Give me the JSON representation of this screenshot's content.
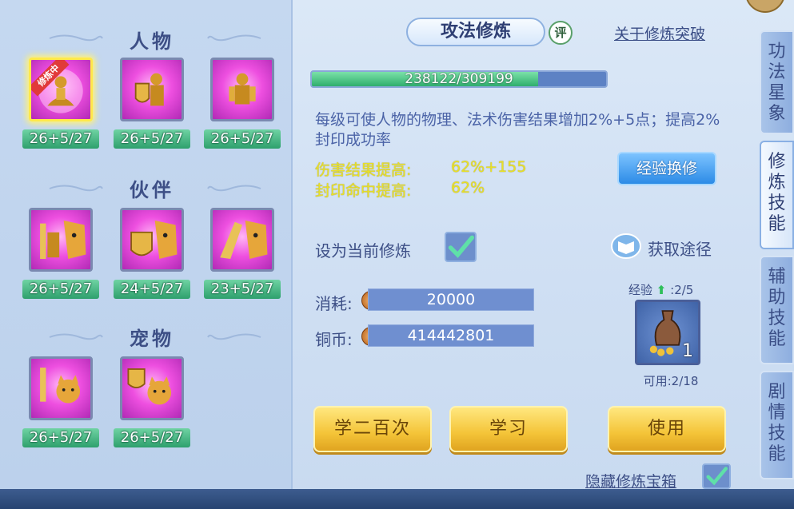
{
  "left": {
    "sections": [
      {
        "title": "人物",
        "items": [
          {
            "level": "26+5/27",
            "icon": "meditating-figure-icon",
            "selected": true,
            "ribbon": "修炼中"
          },
          {
            "level": "26+5/27",
            "icon": "shield-warrior-icon",
            "selected": false
          },
          {
            "level": "26+5/27",
            "icon": "armored-warrior-icon",
            "selected": false
          }
        ]
      },
      {
        "title": "伙伴",
        "items": [
          {
            "level": "26+5/27",
            "icon": "tiger-sword-icon"
          },
          {
            "level": "24+5/27",
            "icon": "tiger-shield-icon"
          },
          {
            "level": "23+5/27",
            "icon": "tiger-fist-icon"
          }
        ]
      },
      {
        "title": "宠物",
        "items": [
          {
            "level": "26+5/27",
            "icon": "cat-sword-icon"
          },
          {
            "level": "26+5/27",
            "icon": "cat-shield-icon"
          }
        ]
      }
    ]
  },
  "main": {
    "title": "攻法修炼",
    "rate_label": "评",
    "about_link": "关于修炼突破",
    "progress": {
      "text": "238122/309199",
      "fraction": 0.77
    },
    "description": "每级可使人物的物理、法术伤害结果增加2%+5点；提高2%封印成功率",
    "stats": [
      {
        "label": "伤害结果提高:",
        "value": "62%+155"
      },
      {
        "label": "封印命中提高:",
        "value": "62%"
      }
    ],
    "exp_convert_button": "经验换修",
    "set_current_label": "设为当前修炼",
    "set_current_checked": true,
    "acquire_label": "获取途径",
    "cost_label": "消耗:",
    "cost_value": "20000",
    "coin_label": "铜币:",
    "coin_value": "414442801",
    "exp_label": "经验",
    "exp_count": ":2/5",
    "item_count": "1",
    "available": "可用:2/18",
    "buttons": {
      "learn200": "学二百次",
      "learn": "学习",
      "use": "使用"
    },
    "hide_label": "隐藏修炼宝箱",
    "hide_checked": true
  },
  "tabs": [
    {
      "label": "功\n法\n星\n象",
      "active": false
    },
    {
      "label": "修\n炼\n技\n能",
      "active": true
    },
    {
      "label": "辅\n助\n技\n能",
      "active": false
    },
    {
      "label": "剧\n情\n技\n能",
      "active": false
    }
  ],
  "colors": {
    "accent_gold": "#f4c438",
    "stat_yellow": "#e8e028",
    "progress_green": "#2fae6d"
  }
}
